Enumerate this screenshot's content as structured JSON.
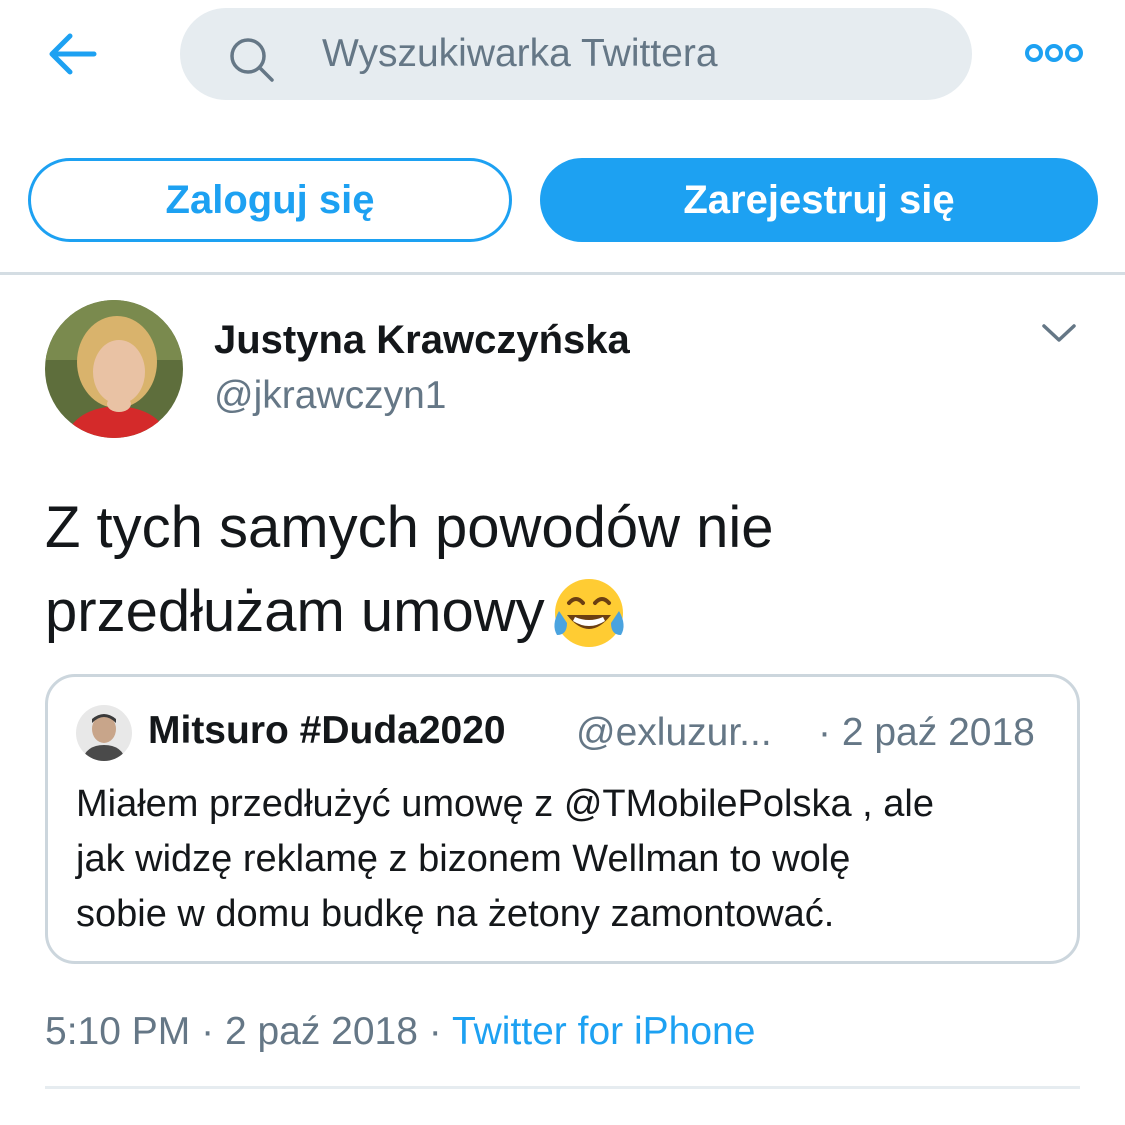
{
  "header": {
    "back_icon": "arrow-left-icon",
    "search_placeholder": "Wyszukiwarka Twittera",
    "more_icon": "more-dots-icon"
  },
  "auth": {
    "login_label": "Zaloguj się",
    "signup_label": "Zarejestruj się"
  },
  "tweet": {
    "author_name": "Justyna Krawczyńska",
    "author_handle": "@jkrawczyn1",
    "text_line1": "Z tych samych powodów nie",
    "text_line2": "przedłużam umowy",
    "emoji": "face-with-tears-of-joy",
    "timestamp": "5:10 PM",
    "separator": "·",
    "date": "2 paź 2018",
    "source": "Twitter for iPhone"
  },
  "quoted": {
    "author_name": "Mitsuro #Duda2020",
    "author_handle": "@exluzur...",
    "date": "· 2 paź 2018",
    "text_line1": "Miałem przedłużyć umowę z @TMobilePolska , ale",
    "text_line2": "jak widzę reklamę z bizonem Wellman to wolę",
    "text_line3": "sobie w domu budkę na żetony zamontować."
  },
  "colors": {
    "accent": "#1da1f2",
    "secondary_text": "#657786",
    "primary_text": "#14171a",
    "search_bg": "#e6ecf0",
    "border": "#ccd6dd"
  }
}
